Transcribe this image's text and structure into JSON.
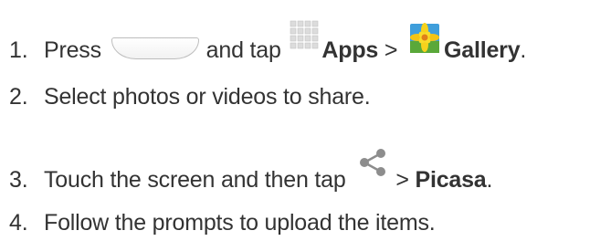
{
  "steps": [
    {
      "number": "1.",
      "text_a": "Press",
      "text_b": "and tap",
      "apps_label": "Apps",
      "separator": ">",
      "gallery_label": "Gallery",
      "end": "."
    },
    {
      "number": "2.",
      "text": "Select photos or videos to share."
    },
    {
      "number": "3.",
      "text_a": "Touch the screen and then tap",
      "separator": ">",
      "picasa_label": "Picasa",
      "end": "."
    },
    {
      "number": "4.",
      "text": "Follow the prompts to upload the items."
    }
  ],
  "icons": {
    "home_key": "home-key-icon",
    "apps": "apps-grid-icon",
    "gallery": "gallery-icon",
    "share": "share-icon"
  }
}
